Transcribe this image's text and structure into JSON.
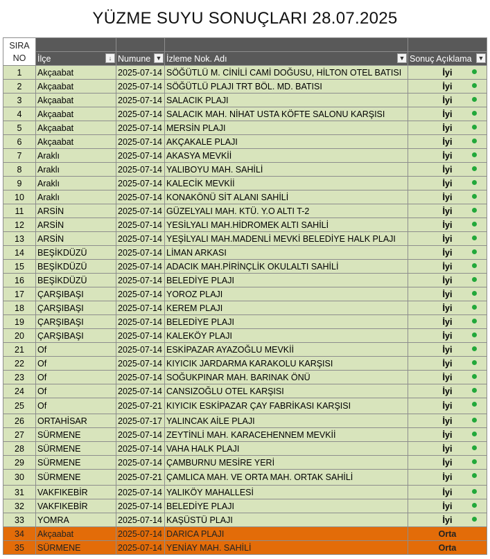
{
  "title": "YÜZME SUYU SONUÇLARI 28.07.2025",
  "headers": {
    "sira_line1": "SIRA",
    "sira_line2": "NO",
    "ilce": "İlçe",
    "numune": "Numune",
    "izleme": "İzleme Nok. Adı",
    "sonuc": "Sonuç Açıklama"
  },
  "colors": {
    "green_row": "#d8e4bc",
    "orange_row": "#e36c09",
    "header": "#595959",
    "dot": "#22a83a"
  },
  "rows": [
    {
      "no": "1",
      "ilce": "Akçaabat",
      "date": "2025-07-14",
      "name": "SÖĞÜTLÜ M. CİNİLİ CAMİ DOĞUSU, HİLTON OTEL BATISI",
      "result": "İyi",
      "status": "good"
    },
    {
      "no": "2",
      "ilce": "Akçaabat",
      "date": "2025-07-14",
      "name": "SÖĞÜTLÜ PLAJI TRT BÖL. MD. BATISI",
      "result": "İyi",
      "status": "good"
    },
    {
      "no": "3",
      "ilce": "Akçaabat",
      "date": "2025-07-14",
      "name": "SALACIK PLAJI",
      "result": "İyi",
      "status": "good"
    },
    {
      "no": "4",
      "ilce": "Akçaabat",
      "date": "2025-07-14",
      "name": "SALACIK MAH. NİHAT USTA KÖFTE SALONU KARŞISI",
      "result": "İyi",
      "status": "good"
    },
    {
      "no": "5",
      "ilce": "Akçaabat",
      "date": "2025-07-14",
      "name": "MERSİN PLAJI",
      "result": "İyi",
      "status": "good"
    },
    {
      "no": "6",
      "ilce": "Akçaabat",
      "date": "2025-07-14",
      "name": "AKÇAKALE PLAJI",
      "result": "İyi",
      "status": "good"
    },
    {
      "no": "7",
      "ilce": "Araklı",
      "date": "2025-07-14",
      "name": "AKASYA MEVKİİ",
      "result": "İyi",
      "status": "good"
    },
    {
      "no": "8",
      "ilce": "Araklı",
      "date": "2025-07-14",
      "name": "YALIBOYU MAH. SAHİLİ",
      "result": "İyi",
      "status": "good"
    },
    {
      "no": "9",
      "ilce": "Araklı",
      "date": "2025-07-14",
      "name": "KALECİK MEVKİİ",
      "result": "İyi",
      "status": "good"
    },
    {
      "no": "10",
      "ilce": "Araklı",
      "date": "2025-07-14",
      "name": "KONAKÖNÜ SİT ALANI SAHİLİ",
      "result": "İyi",
      "status": "good"
    },
    {
      "no": "11",
      "ilce": "ARSİN",
      "date": "2025-07-14",
      "name": "GÜZELYALI MAH. KTÜ. Y.O ALTI T-2",
      "result": "İyi",
      "status": "good"
    },
    {
      "no": "12",
      "ilce": "ARSİN",
      "date": "2025-07-14",
      "name": "YESİLYALI MAH.HİDROMEK ALTI SAHİLİ",
      "result": "İyi",
      "status": "good"
    },
    {
      "no": "13",
      "ilce": "ARSİN",
      "date": "2025-07-14",
      "name": "YEŞİLYALI MAH.MADENLİ MEVKİ BELEDİYE HALK PLAJI",
      "result": "İyi",
      "status": "good"
    },
    {
      "no": "14",
      "ilce": "BEŞİKDÜZÜ",
      "date": "2025-07-14",
      "name": "LİMAN ARKASI",
      "result": "İyi",
      "status": "good"
    },
    {
      "no": "15",
      "ilce": "BEŞİKDÜZÜ",
      "date": "2025-07-14",
      "name": "ADACIK MAH.PİRİNÇLİK OKULALTI SAHİLİ",
      "result": "İyi",
      "status": "good"
    },
    {
      "no": "16",
      "ilce": "BEŞİKDÜZÜ",
      "date": "2025-07-14",
      "name": "BELEDİYE PLAJI",
      "result": "İyi",
      "status": "good"
    },
    {
      "no": "17",
      "ilce": "ÇARŞIBAŞI",
      "date": "2025-07-14",
      "name": "YOROZ PLAJI",
      "result": "İyi",
      "status": "good"
    },
    {
      "no": "18",
      "ilce": "ÇARŞIBAŞI",
      "date": "2025-07-14",
      "name": "KEREM PLAJI",
      "result": "İyi",
      "status": "good"
    },
    {
      "no": "19",
      "ilce": "ÇARŞIBAŞI",
      "date": "2025-07-14",
      "name": "BELEDİYE  PLAJI",
      "result": "İyi",
      "status": "good"
    },
    {
      "no": "20",
      "ilce": "ÇARŞIBAŞI",
      "date": "2025-07-14",
      "name": "KALEKÖY PLAJI",
      "result": "İyi",
      "status": "good"
    },
    {
      "no": "21",
      "ilce": "Of",
      "date": "2025-07-14",
      "name": "ESKİPAZAR AYAZOĞLU MEVKİİ",
      "result": "İyi",
      "status": "good"
    },
    {
      "no": "22",
      "ilce": "Of",
      "date": "2025-07-14",
      "name": "KIYICIK JARDARMA KARAKOLU KARŞISI",
      "result": "İyi",
      "status": "good"
    },
    {
      "no": "23",
      "ilce": "Of",
      "date": "2025-07-14",
      "name": "SOĞUKPINAR MAH. BARINAK ÖNÜ",
      "result": "İyi",
      "status": "good"
    },
    {
      "no": "24",
      "ilce": "Of",
      "date": "2025-07-14",
      "name": "CANSIZOĞLU OTEL KARŞISI",
      "result": "İyi",
      "status": "good"
    },
    {
      "no": "25",
      "ilce": "Of",
      "date": "2025-07-21",
      "name": "KIYICIK ESKİPAZAR  ÇAY  FABRİKASI KARŞISI",
      "result": "İyi",
      "status": "good",
      "tall": true
    },
    {
      "no": "26",
      "ilce": "ORTAHİSAR",
      "date": "2025-07-17",
      "name": "YALINCAK AİLE PLAJI",
      "result": "İyi",
      "status": "good"
    },
    {
      "no": "27",
      "ilce": "SÜRMENE",
      "date": "2025-07-14",
      "name": "ZEYTİNLİ MAH. KARACEHENNEM MEVKİİ",
      "result": "İyi",
      "status": "good"
    },
    {
      "no": "28",
      "ilce": "SÜRMENE",
      "date": "2025-07-14",
      "name": "VAHA HALK PLAJI",
      "result": "İyi",
      "status": "good"
    },
    {
      "no": "29",
      "ilce": "SÜRMENE",
      "date": "2025-07-14",
      "name": "ÇAMBURNU MESİRE YERİ",
      "result": "İyi",
      "status": "good"
    },
    {
      "no": "30",
      "ilce": "SÜRMENE",
      "date": "2025-07-21",
      "name": "ÇAMLICA MAH. VE ORTA MAH. ORTAK SAHİLİ",
      "result": "İyi",
      "status": "good",
      "tall": true
    },
    {
      "no": "31",
      "ilce": "VAKFIKEBİR",
      "date": "2025-07-14",
      "name": "YALIKÖY MAHALLESİ",
      "result": "İyi",
      "status": "good"
    },
    {
      "no": "32",
      "ilce": "VAKFIKEBİR",
      "date": "2025-07-14",
      "name": "BELEDİYE PLAJI",
      "result": "İyi",
      "status": "good"
    },
    {
      "no": "33",
      "ilce": "YOMRA",
      "date": "2025-07-14",
      "name": "KAŞÜSTÜ PLAJI",
      "result": "İyi",
      "status": "good"
    },
    {
      "no": "34",
      "ilce": "Akçaabat",
      "date": "2025-07-14",
      "name": "DARICA PLAJI",
      "result": "Orta",
      "status": "medium"
    },
    {
      "no": "35",
      "ilce": "SÜRMENE",
      "date": "2025-07-14",
      "name": "YENİAY MAH. SAHİLİ",
      "result": "Orta",
      "status": "medium"
    }
  ]
}
